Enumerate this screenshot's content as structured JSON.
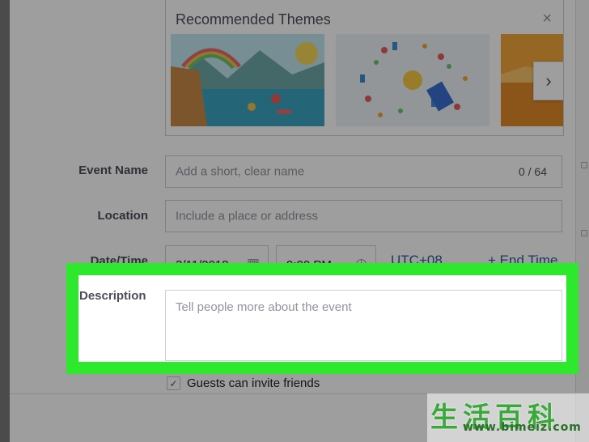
{
  "themes": {
    "title": "Recommended Themes",
    "close_icon": "close-icon",
    "next_icon": "chevron-right-icon",
    "close_glyph": "×",
    "next_glyph": "›"
  },
  "form": {
    "event_name": {
      "label": "Event Name",
      "placeholder": "Add a short, clear name",
      "counter": "0 / 64"
    },
    "location": {
      "label": "Location",
      "placeholder": "Include a place or address"
    },
    "datetime": {
      "label": "Date/Time",
      "date": "3/11/2018",
      "date_icon": "calendar-icon",
      "time": "9:00 PM",
      "time_icon": "clock-icon",
      "timezone": "UTC+08",
      "end_time": "+ End Time"
    },
    "description": {
      "label": "Description",
      "placeholder": "Tell people more about the event"
    },
    "guests": {
      "label": "Guests can invite friends",
      "checked": true
    }
  },
  "colors": {
    "highlight": "#2ee82e",
    "link": "#365899"
  },
  "watermark": {
    "chars": "生活百科",
    "url": "www.bimeiz.com"
  }
}
